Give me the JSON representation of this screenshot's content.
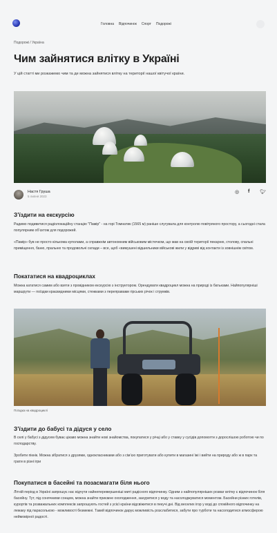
{
  "header": {
    "nav": [
      "Головна",
      "Відпочинок",
      "Спорт",
      "Подорожі"
    ]
  },
  "breadcrumb": "Подорожі / Україна",
  "article": {
    "title": "Чим зайнятися влітку в Україні",
    "lead": "У цій статті ми розкажемо чим та де можна зайнятися влітку на території нашої квітучої країни.",
    "author": {
      "name": "Настя Груша",
      "date": "5 липня 2023"
    },
    "social_icons": [
      "instagram-icon",
      "facebook-icon",
      "twitter-icon"
    ],
    "sections": [
      {
        "heading": "З’їздити на екскурсію",
        "paragraphs": [
          "Радимо подивитися радіолокаційну станцію \"Памір\" - на горі Томнатик (1565 м) раніше слугувала для контролю повітряного простору, а сьогодні стала популярним об’єктом для подорожей.",
          "«Памір» був не просто кількома куполами, а справжнім автономним військовим містечком, що мав на своїй території пекарню, столову, спальні приміщення, баню, пральню та продовольчі склади – все, щоб «вимушені відшельники військові жили у відриві від контакти із зовнішнім світом."
        ]
      },
      {
        "heading": "Покататися на квадроциклах",
        "paragraphs": [
          "Можна кататися самим або взяти з провідником екскурсію з інструктором. Орендувати квадроцикл можна на природі із батьками. Найпопулярніші маршрути — поїздки краєвидними місцями, стежками з переправами гірських річок і струмків."
        ]
      },
      {
        "heading": "З’їздити до бабусі та дідуся у село",
        "paragraphs": [
          "В селі у бабусі з дідусем буває цікаво можна знайти нові знайомства, покупатися у річці або у ставку у сусідів допомогти з дорослішою роботою чи по господарству.",
          "Зробити пікнік. Можна зібратися з друзями, однокласниками або з сім’єю приготувати або купити в магазині їжі і вийти на природу або ж в парк та грати в різні ігри"
        ]
      },
      {
        "heading": "Покупатися в басейні та позасмагати біля нього",
        "paragraphs": [
          "Літній період в Україні запрошує нас відчути найнеперевершеніші миті радісного відпочинку. Одним з найпопулярніших розваг влітку є відпочинок біля басейну. Тут, під сонячними сонцем, можна знайти приємне охолодження, зануритися у воду та насолоджуватися моментом. Басейни різних готелів, курортів та розважальних комплексів запрошують гостей з усієї країни відсвіжитися в пекучі дні. Від веселих ігор у воді до спокійного відпочинку на лежаку під парасолькою - можливості безмежні. Такий відпочинок дарує можливість розслабитися, забути про турботи та насолодитися атмосферою неймовірної радості."
        ]
      }
    ],
    "photo_caption": "Поїздка на квадроциклі"
  }
}
